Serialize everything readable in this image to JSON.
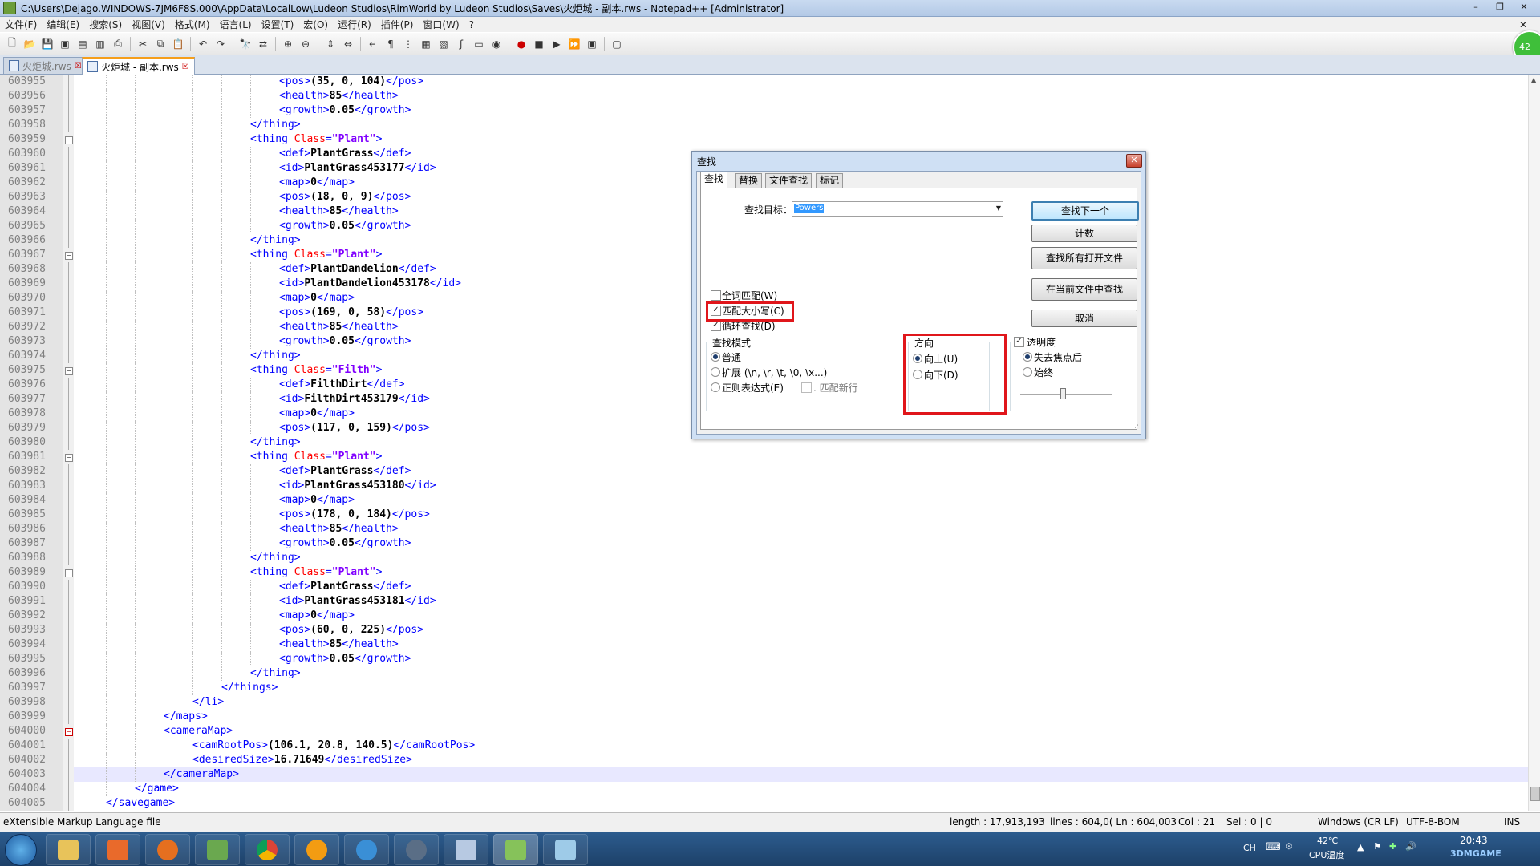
{
  "window": {
    "title": "C:\\Users\\Dejago.WINDOWS-7JM6F8S.000\\AppData\\LocalLow\\Ludeon Studios\\RimWorld by Ludeon Studios\\Saves\\火炬城 - 副本.rws - Notepad++ [Administrator]",
    "minimize": "–",
    "maximize": "❐",
    "close": "✕"
  },
  "menu": {
    "items": [
      "文件(F)",
      "编辑(E)",
      "搜索(S)",
      "视图(V)",
      "格式(M)",
      "语言(L)",
      "设置(T)",
      "宏(O)",
      "运行(R)",
      "插件(P)",
      "窗口(W)",
      "?"
    ],
    "close_doc": "✕"
  },
  "tabs": [
    {
      "label": "火炬城.rws",
      "close": "☒"
    },
    {
      "label": "火炬城 - 副本.rws",
      "close": "☒"
    }
  ],
  "badge": "42",
  "editor": {
    "lines": [
      {
        "n": "603955",
        "code": "<pos>(35, 0, 104)</pos>"
      },
      {
        "n": "603956",
        "code": "<health>85</health>"
      },
      {
        "n": "603957",
        "code": "<growth>0.05</growth>"
      },
      {
        "n": "603958",
        "code": "</thing>"
      },
      {
        "n": "603959",
        "code": "<thing Class=\"Plant\">"
      },
      {
        "n": "603960",
        "code": "<def>PlantGrass</def>"
      },
      {
        "n": "603961",
        "code": "<id>PlantGrass453177</id>"
      },
      {
        "n": "603962",
        "code": "<map>0</map>"
      },
      {
        "n": "603963",
        "code": "<pos>(18, 0, 9)</pos>"
      },
      {
        "n": "603964",
        "code": "<health>85</health>"
      },
      {
        "n": "603965",
        "code": "<growth>0.05</growth>"
      },
      {
        "n": "603966",
        "code": "</thing>"
      },
      {
        "n": "603967",
        "code": "<thing Class=\"Plant\">"
      },
      {
        "n": "603968",
        "code": "<def>PlantDandelion</def>"
      },
      {
        "n": "603969",
        "code": "<id>PlantDandelion453178</id>"
      },
      {
        "n": "603970",
        "code": "<map>0</map>"
      },
      {
        "n": "603971",
        "code": "<pos>(169, 0, 58)</pos>"
      },
      {
        "n": "603972",
        "code": "<health>85</health>"
      },
      {
        "n": "603973",
        "code": "<growth>0.05</growth>"
      },
      {
        "n": "603974",
        "code": "</thing>"
      },
      {
        "n": "603975",
        "code": "<thing Class=\"Filth\">"
      },
      {
        "n": "603976",
        "code": "<def>FilthDirt</def>"
      },
      {
        "n": "603977",
        "code": "<id>FilthDirt453179</id>"
      },
      {
        "n": "603978",
        "code": "<map>0</map>"
      },
      {
        "n": "603979",
        "code": "<pos>(117, 0, 159)</pos>"
      },
      {
        "n": "603980",
        "code": "</thing>"
      },
      {
        "n": "603981",
        "code": "<thing Class=\"Plant\">"
      },
      {
        "n": "603982",
        "code": "<def>PlantGrass</def>"
      },
      {
        "n": "603983",
        "code": "<id>PlantGrass453180</id>"
      },
      {
        "n": "603984",
        "code": "<map>0</map>"
      },
      {
        "n": "603985",
        "code": "<pos>(178, 0, 184)</pos>"
      },
      {
        "n": "603986",
        "code": "<health>85</health>"
      },
      {
        "n": "603987",
        "code": "<growth>0.05</growth>"
      },
      {
        "n": "603988",
        "code": "</thing>"
      },
      {
        "n": "603989",
        "code": "<thing Class=\"Plant\">"
      },
      {
        "n": "603990",
        "code": "<def>PlantGrass</def>"
      },
      {
        "n": "603991",
        "code": "<id>PlantGrass453181</id>"
      },
      {
        "n": "603992",
        "code": "<map>0</map>"
      },
      {
        "n": "603993",
        "code": "<pos>(60, 0, 225)</pos>"
      },
      {
        "n": "603994",
        "code": "<health>85</health>"
      },
      {
        "n": "603995",
        "code": "<growth>0.05</growth>"
      },
      {
        "n": "603996",
        "code": "</thing>"
      },
      {
        "n": "603997",
        "code": "</things>"
      },
      {
        "n": "603998",
        "code": "</li>"
      },
      {
        "n": "603999",
        "code": "</maps>"
      },
      {
        "n": "604000",
        "code": "<cameraMap>"
      },
      {
        "n": "604001",
        "code": "<camRootPos>(106.1, 20.8, 140.5)</camRootPos>"
      },
      {
        "n": "604002",
        "code": "<desiredSize>16.71649</desiredSize>"
      },
      {
        "n": "604003",
        "code": "</cameraMap>"
      },
      {
        "n": "604004",
        "code": "</game>"
      },
      {
        "n": "604005",
        "code": "</savegame>"
      }
    ]
  },
  "status": {
    "filetype": "eXtensible Markup Language file",
    "length": "length : 17,913,193",
    "lines": "lines : 604,0( Ln : 604,003",
    "col": "Col : 21",
    "sel": "Sel : 0 | 0",
    "eol": "Windows (CR LF)",
    "encoding": "UTF-8-BOM",
    "mode": "INS"
  },
  "dialog": {
    "title": "查找",
    "close": "✕",
    "tabs": [
      "查找",
      "替换",
      "文件查找",
      "标记"
    ],
    "find_label": "查找目标：",
    "find_value": "Powers",
    "buttons": {
      "find_next": "查找下一个",
      "count": "计数",
      "find_all_open": "查找所有打开文件",
      "find_all_current": "在当前文件中查找",
      "cancel": "取消"
    },
    "options": {
      "whole_word": "全词匹配(W)",
      "match_case": "匹配大小写(C)",
      "wrap": "循环查找(D)"
    },
    "search_mode": {
      "title": "查找模式",
      "normal": "普通",
      "extended": "扩展 (\\n, \\r, \\t, \\0, \\x...)",
      "regex": "正则表达式(E)",
      "dot_newline": ". 匹配新行"
    },
    "direction": {
      "title": "方向",
      "up": "向上(U)",
      "down": "向下(D)"
    },
    "transparency": {
      "title": "透明度",
      "on_lose_focus": "失去焦点后",
      "always": "始终"
    },
    "check": "✓"
  },
  "taskbar": {
    "tray": {
      "lang": "CH",
      "temp": "42℃",
      "temp_label": "CPU温度",
      "time": "20:43",
      "watermark": "3DMGAME"
    }
  }
}
